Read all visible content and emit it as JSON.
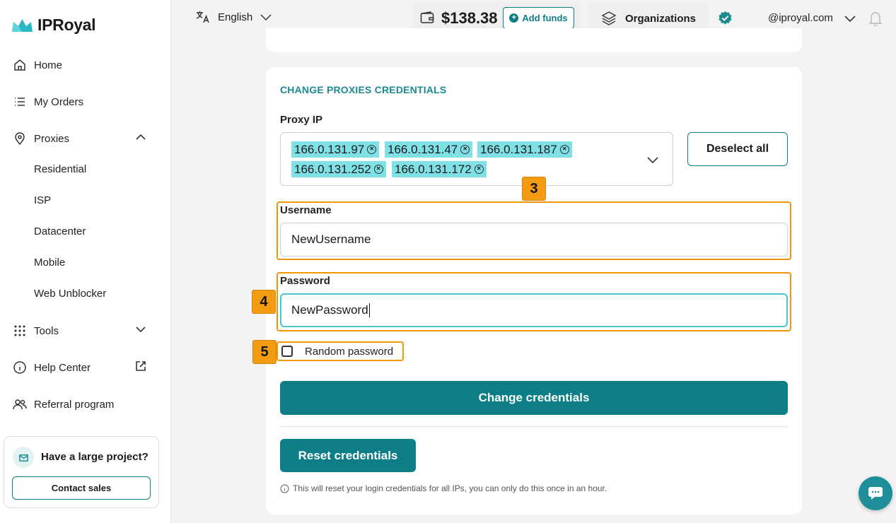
{
  "brand": {
    "name": "IPRoyal",
    "accent": "#0e7e86"
  },
  "sidebar": {
    "items": [
      {
        "label": "Home",
        "icon": "home-icon"
      },
      {
        "label": "My Orders",
        "icon": "list-icon"
      },
      {
        "label": "Proxies",
        "icon": "location-pin-icon"
      },
      {
        "label": "Tools",
        "icon": "grid-dots-icon"
      },
      {
        "label": "Help Center",
        "icon": "info-icon"
      },
      {
        "label": "Referral program",
        "icon": "users-icon"
      }
    ],
    "proxies_sub": [
      "Residential",
      "ISP",
      "Datacenter",
      "Mobile",
      "Web Unblocker"
    ],
    "promo": {
      "title": "Have a large project?",
      "button": "Contact sales"
    }
  },
  "topbar": {
    "language": "English",
    "balance": "$138.38",
    "add_funds": "Add funds",
    "organizations": "Organizations",
    "email": "@iproyal.com"
  },
  "form": {
    "section_title": "CHANGE PROXIES CREDENTIALS",
    "proxy_ip_label": "Proxy IP",
    "proxy_ips": [
      "166.0.131.97",
      "166.0.131.47",
      "166.0.131.187",
      "166.0.131.252",
      "166.0.131.172"
    ],
    "deselect_all": "Deselect all",
    "username_label": "Username",
    "username_value": "NewUsername",
    "password_label": "Password",
    "password_value": "NewPassword",
    "random_password_label": "Random password",
    "random_password_checked": false,
    "change_button": "Change credentials",
    "reset_button": "Reset credentials",
    "reset_note": "This will reset your login credentials for all IPs, you can only do this once in an hour."
  },
  "annotations": {
    "step3": "3",
    "step4": "4",
    "step5": "5"
  }
}
